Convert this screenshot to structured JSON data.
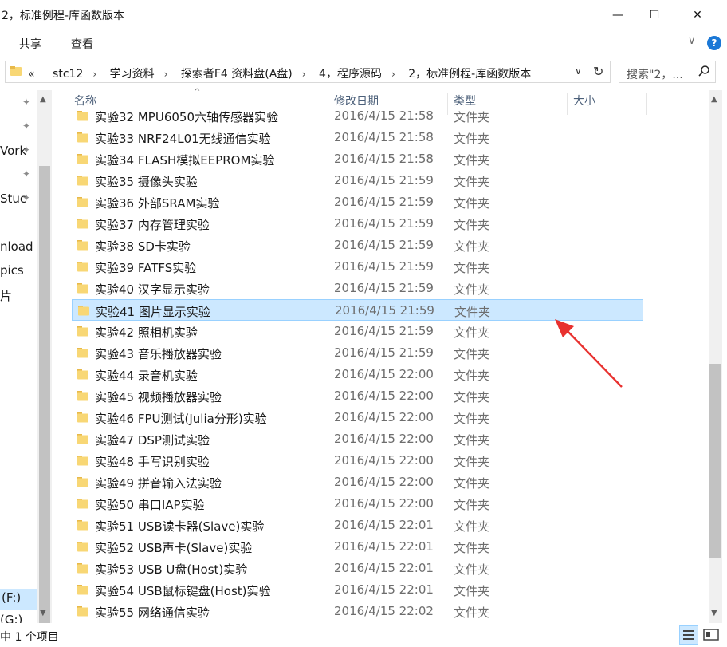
{
  "window": {
    "title": "2，标准例程-库函数版本",
    "minimize_glyph": "—",
    "maximize_glyph": "☐",
    "close_glyph": "✕"
  },
  "ribbon": {
    "tabs": [
      "共享",
      "查看"
    ],
    "expand_glyph": "∨",
    "help_glyph": "?"
  },
  "address": {
    "overflow": "«",
    "crumbs": [
      "stc12",
      "学习资料",
      "探索者F4 资料盘(A盘)",
      "4，程序源码",
      "2，标准例程-库函数版本"
    ],
    "separator": "›",
    "dropdown_glyph": "∨",
    "refresh_glyph": "↻"
  },
  "search": {
    "placeholder": "搜索\"2，...",
    "icon": "search-icon"
  },
  "nav": {
    "items": [
      {
        "label": "",
        "pinned": true
      },
      {
        "label": "",
        "pinned": true
      },
      {
        "label": "Vork",
        "pinned": true
      },
      {
        "label": "",
        "pinned": true
      },
      {
        "label": "Stuc",
        "pinned": true
      },
      {
        "label": "nload",
        "pinned": false
      },
      {
        "label": "pics",
        "pinned": false
      },
      {
        "label": "片",
        "pinned": false
      },
      {
        "label": "(F:)",
        "pinned": false
      },
      {
        "label": "(G:)",
        "pinned": false
      }
    ],
    "pin_glyph": "📌"
  },
  "columns": {
    "name": "名称",
    "date": "修改日期",
    "type": "类型",
    "size": "大小"
  },
  "files": [
    {
      "name": "实验32 MPU6050六轴传感器实验",
      "date": "2016/4/15 21:58",
      "type": "文件夹"
    },
    {
      "name": "实验33 NRF24L01无线通信实验",
      "date": "2016/4/15 21:58",
      "type": "文件夹"
    },
    {
      "name": "实验34 FLASH模拟EEPROM实验",
      "date": "2016/4/15 21:58",
      "type": "文件夹"
    },
    {
      "name": "实验35 摄像头实验",
      "date": "2016/4/15 21:59",
      "type": "文件夹"
    },
    {
      "name": "实验36 外部SRAM实验",
      "date": "2016/4/15 21:59",
      "type": "文件夹"
    },
    {
      "name": "实验37 内存管理实验",
      "date": "2016/4/15 21:59",
      "type": "文件夹"
    },
    {
      "name": "实验38 SD卡实验",
      "date": "2016/4/15 21:59",
      "type": "文件夹"
    },
    {
      "name": "实验39 FATFS实验",
      "date": "2016/4/15 21:59",
      "type": "文件夹"
    },
    {
      "name": "实验40 汉字显示实验",
      "date": "2016/4/15 21:59",
      "type": "文件夹"
    },
    {
      "name": "实验41 图片显示实验",
      "date": "2016/4/15 21:59",
      "type": "文件夹",
      "selected": true
    },
    {
      "name": "实验42 照相机实验",
      "date": "2016/4/15 21:59",
      "type": "文件夹"
    },
    {
      "name": "实验43 音乐播放器实验",
      "date": "2016/4/15 21:59",
      "type": "文件夹"
    },
    {
      "name": "实验44 录音机实验",
      "date": "2016/4/15 22:00",
      "type": "文件夹"
    },
    {
      "name": "实验45 视频播放器实验",
      "date": "2016/4/15 22:00",
      "type": "文件夹"
    },
    {
      "name": "实验46 FPU测试(Julia分形)实验",
      "date": "2016/4/15 22:00",
      "type": "文件夹"
    },
    {
      "name": "实验47 DSP测试实验",
      "date": "2016/4/15 22:00",
      "type": "文件夹"
    },
    {
      "name": "实验48 手写识别实验",
      "date": "2016/4/15 22:00",
      "type": "文件夹"
    },
    {
      "name": "实验49 拼音输入法实验",
      "date": "2016/4/15 22:00",
      "type": "文件夹"
    },
    {
      "name": "实验50 串口IAP实验",
      "date": "2016/4/15 22:00",
      "type": "文件夹"
    },
    {
      "name": "实验51 USB读卡器(Slave)实验",
      "date": "2016/4/15 22:01",
      "type": "文件夹"
    },
    {
      "name": "实验52 USB声卡(Slave)实验",
      "date": "2016/4/15 22:01",
      "type": "文件夹"
    },
    {
      "name": "实验53 USB U盘(Host)实验",
      "date": "2016/4/15 22:01",
      "type": "文件夹"
    },
    {
      "name": "实验54 USB鼠标键盘(Host)实验",
      "date": "2016/4/15 22:01",
      "type": "文件夹"
    },
    {
      "name": "实验55 网络通信实验",
      "date": "2016/4/15 22:02",
      "type": "文件夹"
    }
  ],
  "status": {
    "text": "中 1 个项目"
  },
  "colors": {
    "selection_bg": "#cce8ff",
    "selection_border": "#99d1ff",
    "folder": "#f8d775",
    "annotation_arrow": "#e8312f"
  }
}
